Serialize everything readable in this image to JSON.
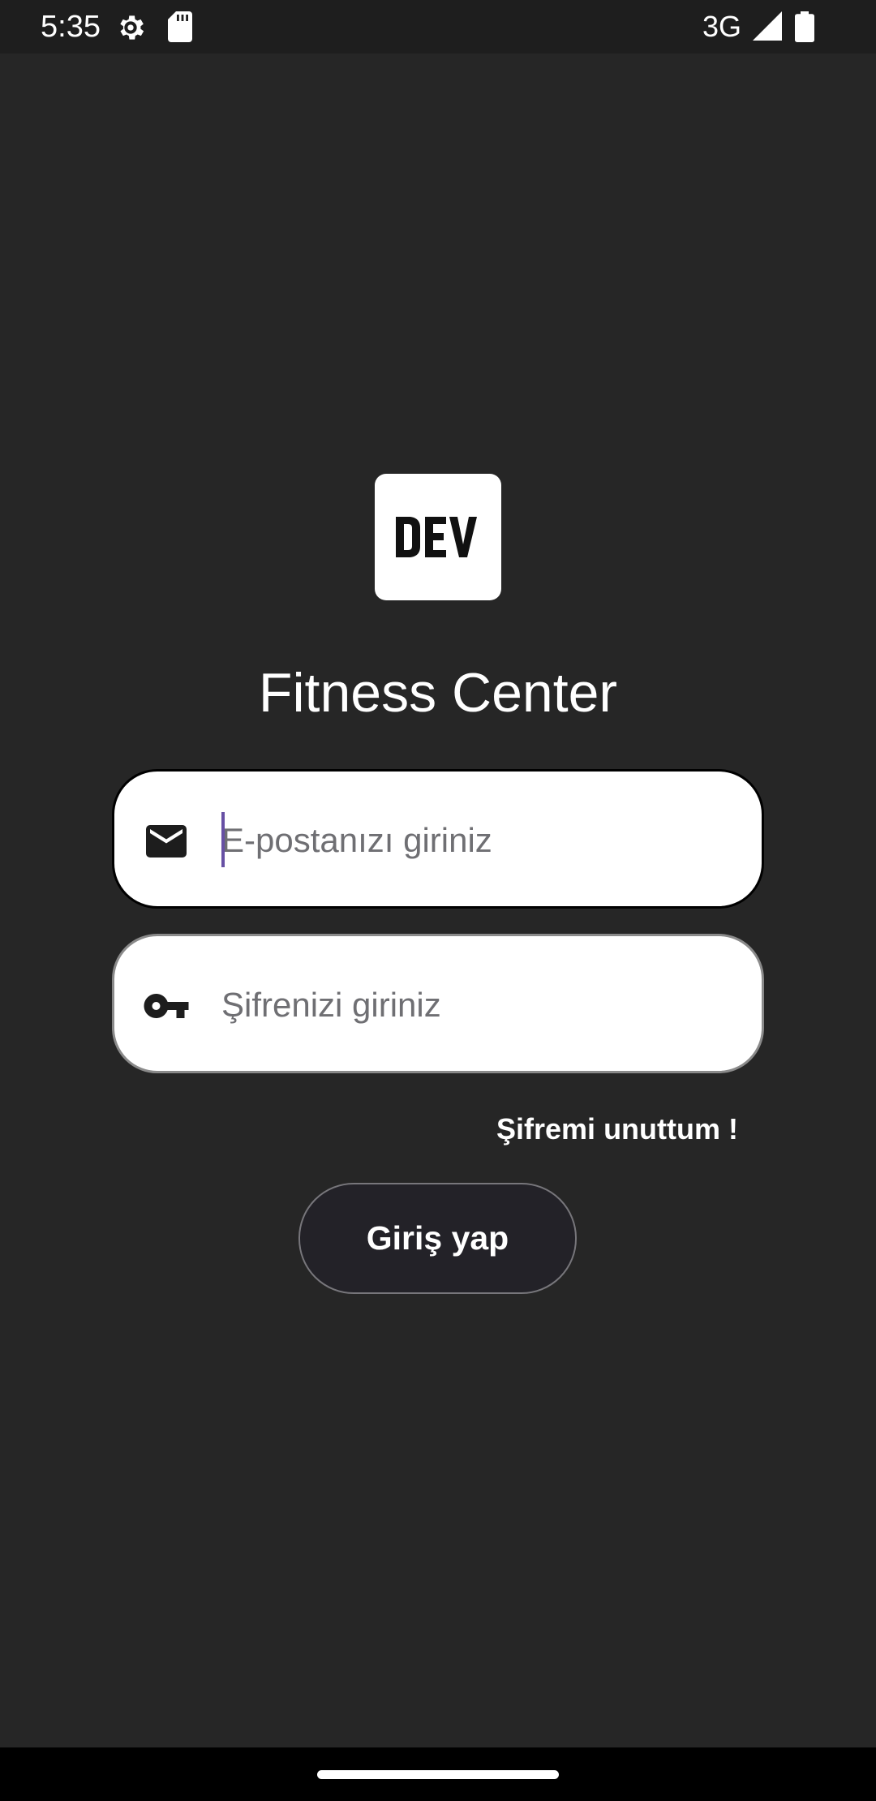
{
  "status_bar": {
    "time": "5:35",
    "network": "3G",
    "icons": [
      "settings-gear-icon",
      "sd-card-icon",
      "signal-icon",
      "battery-icon"
    ]
  },
  "logo": {
    "text": "DEV"
  },
  "app_title": "Fitness Center",
  "email_field": {
    "placeholder": "E-postanızı giriniz",
    "value": "",
    "icon": "mail-icon"
  },
  "password_field": {
    "placeholder": "Şifrenizi giriniz",
    "value": "",
    "icon": "key-icon"
  },
  "forgot_password_label": "Şifremi unuttum !",
  "login_button_label": "Giriş yap",
  "colors": {
    "background": "#262626",
    "status_bar": "#1e1e1e",
    "field_background": "#ffffff",
    "caret": "#6750a4",
    "button_background": "#232228"
  }
}
